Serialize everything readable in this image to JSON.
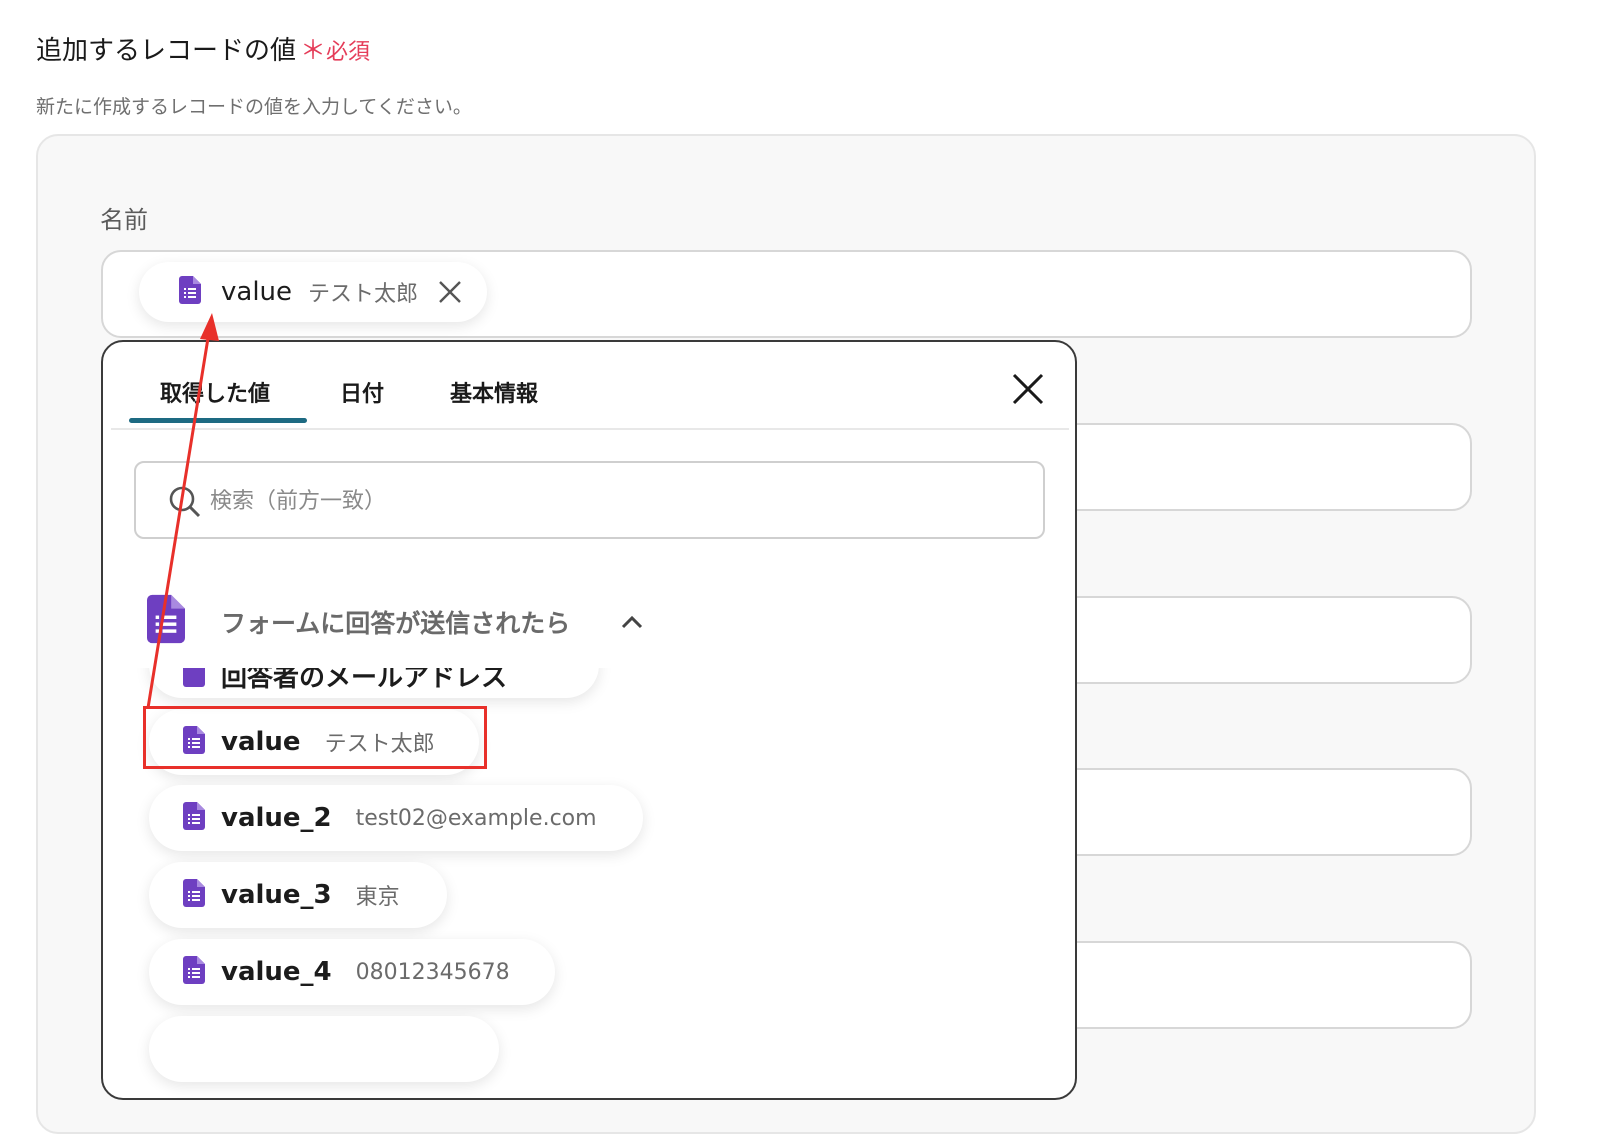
{
  "section": {
    "title": "追加するレコードの値",
    "required_star": "＊",
    "required_label": "必須",
    "description": "新たに作成するレコードの値を入力してください。"
  },
  "field": {
    "label": "名前",
    "chip": {
      "key": "value",
      "value": "テスト太郎"
    }
  },
  "dropdown": {
    "tabs": [
      {
        "label": "取得した値",
        "active": true
      },
      {
        "label": "日付",
        "active": false
      },
      {
        "label": "基本情報",
        "active": false
      }
    ],
    "search_placeholder": "検索（前方一致）",
    "group": {
      "title": "フォームに回答が送信されたら",
      "expanded": true
    },
    "items": [
      {
        "key": "回答者のメールアドレス",
        "value": ""
      },
      {
        "key": "value",
        "value": "テスト太郎",
        "highlighted": true
      },
      {
        "key": "value_2",
        "value": "test02@example.com"
      },
      {
        "key": "value_3",
        "value": "東京"
      },
      {
        "key": "value_4",
        "value": "08012345678"
      }
    ]
  },
  "colors": {
    "accent_tab": "#1d6a82",
    "required": "#e53d59",
    "form_icon": "#6e3fc1",
    "annotation": "#e8302a"
  },
  "icons": [
    "google-forms-icon",
    "close-icon",
    "search-icon",
    "chevron-up-icon"
  ]
}
